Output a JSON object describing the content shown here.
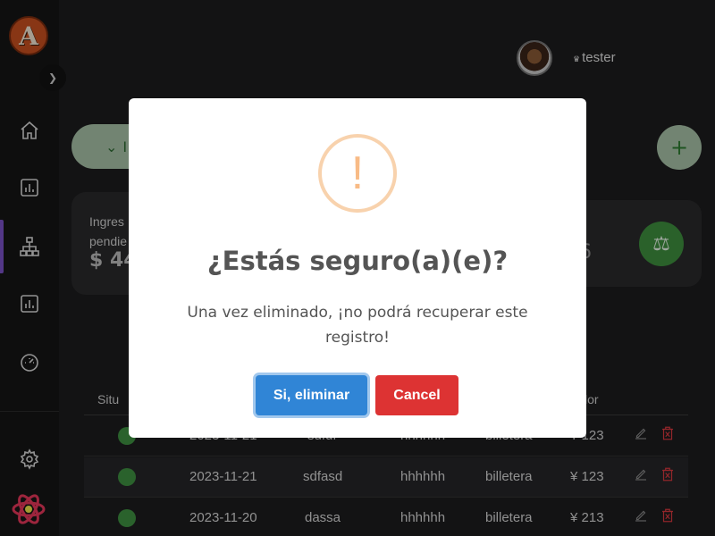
{
  "app": {
    "logo_letter": "A"
  },
  "header": {
    "username": "tester",
    "user_badge": "♛"
  },
  "background": {
    "filter_button_label": "I",
    "add_button_label": "+",
    "card_left": {
      "label_line1": "Ingres",
      "label_line2": "pendie",
      "value": "$ 44"
    },
    "card_right": {
      "value": "6"
    },
    "table": {
      "headers": {
        "status": "Situ",
        "amount": "lor"
      },
      "rows": [
        {
          "date": "2023-11-21",
          "name": "sdfdf",
          "desc": "hhhhhh",
          "account": "billetera",
          "amount": "¥ 123"
        },
        {
          "date": "2023-11-21",
          "name": "sdfasd",
          "desc": "hhhhhh",
          "account": "billetera",
          "amount": "¥ 123"
        },
        {
          "date": "2023-11-20",
          "name": "dassa",
          "desc": "hhhhhh",
          "account": "billetera",
          "amount": "¥ 213"
        }
      ]
    }
  },
  "modal": {
    "icon_glyph": "!",
    "title": "¿Estás seguro(a)(e)?",
    "text": "Una vez eliminado, ¡no podrá recuperar este registro!",
    "confirm_label": "Si, eliminar",
    "cancel_label": "Cancel"
  },
  "colors": {
    "accent": "#7b52c7",
    "confirm": "#3085d6",
    "cancel": "#dd3333",
    "warning": "#f8bb86",
    "status_active": "#3f9142"
  }
}
